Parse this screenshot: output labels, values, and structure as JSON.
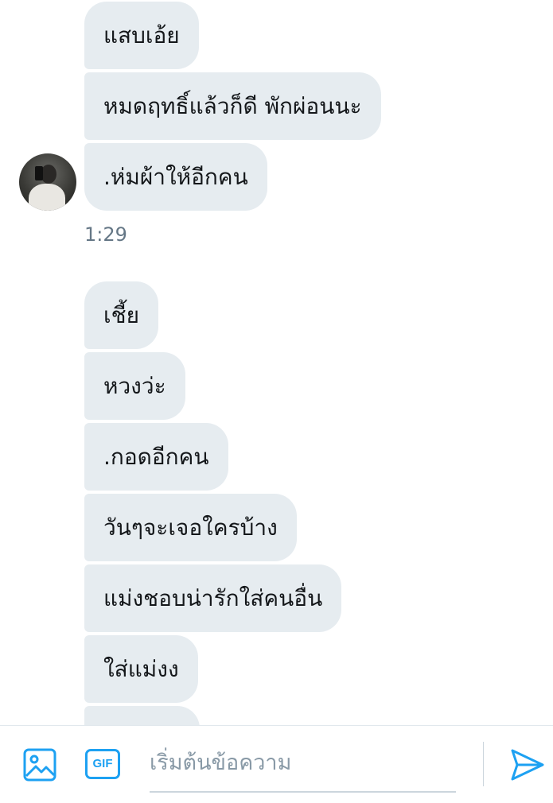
{
  "conversation": {
    "messages_top": [
      {
        "text": "แสบเอ้ย"
      },
      {
        "text": "หมดฤทธิ์แล้วก็ดี พักผ่อนนะ"
      },
      {
        "text": ".ห่มผ้าให้อีกคน"
      }
    ],
    "timestamp": "1:29",
    "messages_bottom": [
      {
        "text": "เชี้ย"
      },
      {
        "text": "หวงว่ะ"
      },
      {
        "text": ".กอดอีกคน"
      },
      {
        "text": "วันๆจะเจอใครบ้าง"
      },
      {
        "text": "แม่งชอบน่ารักใส่คนอื่น"
      },
      {
        "text": "ใส่แม่งง"
      },
      {
        "text": ""
      }
    ]
  },
  "composer": {
    "placeholder": "เริ่มต้นข้อความ",
    "gif_label": "GIF",
    "icons": {
      "media": "image-icon",
      "gif": "gif-icon",
      "send": "send-icon"
    },
    "accent_color": "#1da1f2"
  },
  "colors": {
    "bubble_bg": "#e6ecf0",
    "text": "#14171a",
    "timestamp": "#657786"
  }
}
